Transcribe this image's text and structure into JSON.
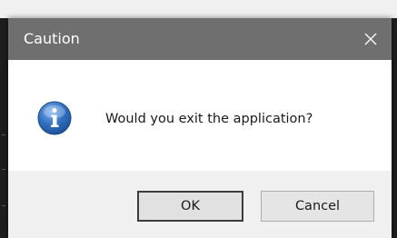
{
  "dialog": {
    "title": "Caution",
    "message": "Would you exit the application?",
    "icon": "info-icon",
    "close_icon": "close-icon"
  },
  "buttons": {
    "ok_label": "OK",
    "cancel_label": "Cancel"
  },
  "colors": {
    "titlebar": "#6f6f6f",
    "info_icon_blue": "#2f6fc0",
    "footer": "#f0f0f0"
  }
}
